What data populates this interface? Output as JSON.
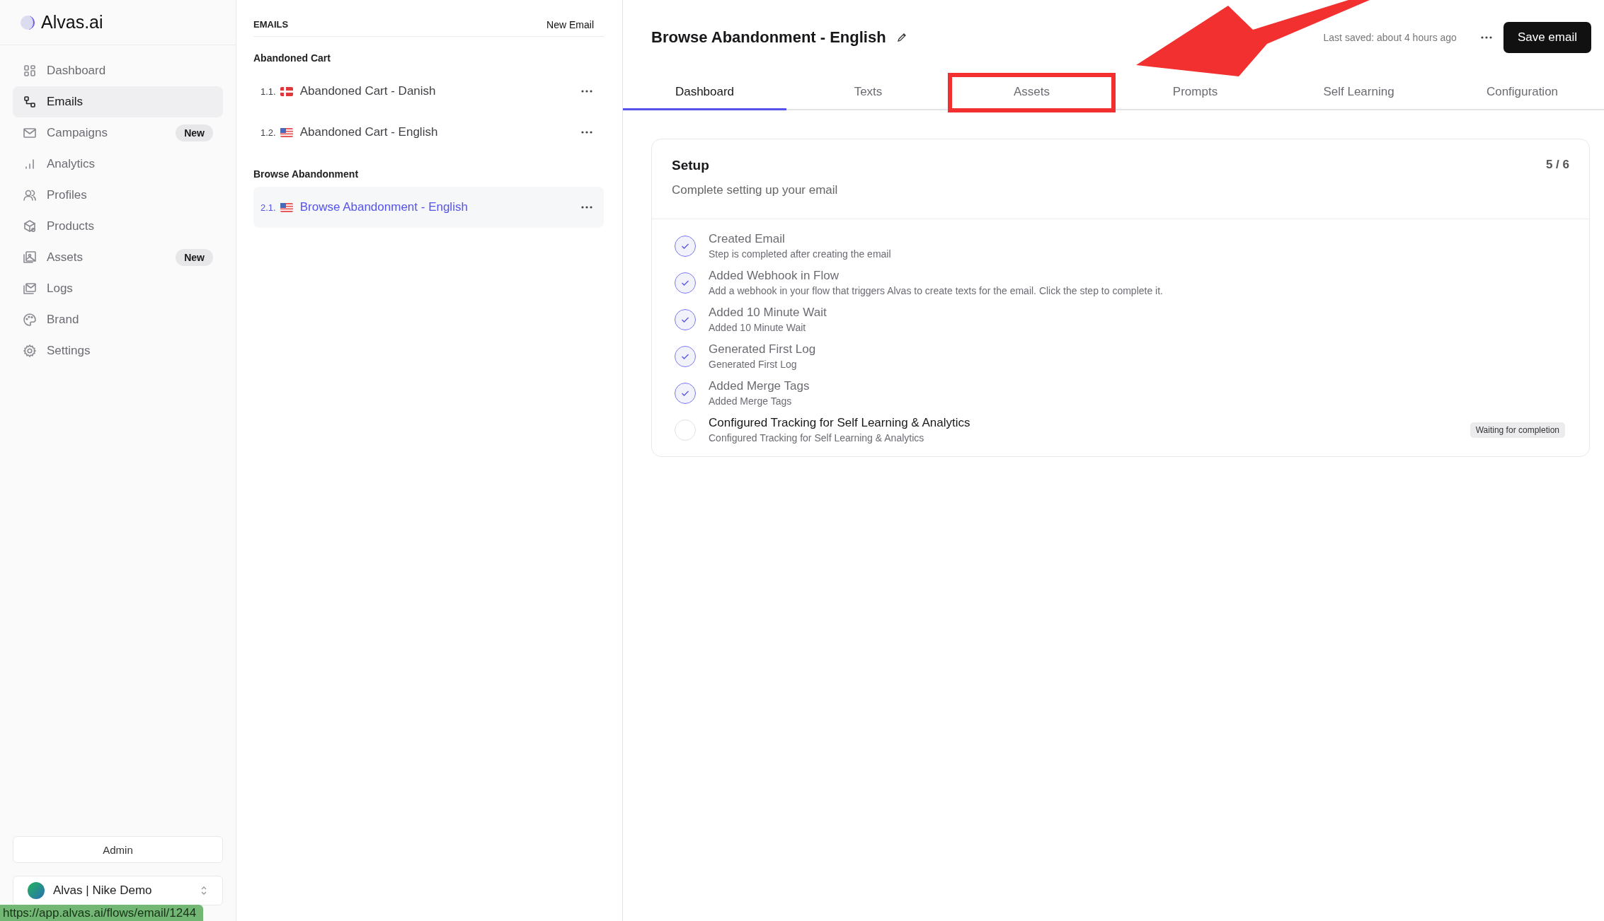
{
  "brand": {
    "name": "Alvas.ai"
  },
  "nav": [
    {
      "label": "Dashboard",
      "selected": false
    },
    {
      "label": "Emails",
      "selected": true
    },
    {
      "label": "Campaigns",
      "selected": false,
      "badge": "New"
    },
    {
      "label": "Analytics",
      "selected": false
    },
    {
      "label": "Profiles",
      "selected": false
    },
    {
      "label": "Products",
      "selected": false
    },
    {
      "label": "Assets",
      "selected": false,
      "badge": "New"
    },
    {
      "label": "Logs",
      "selected": false
    },
    {
      "label": "Brand",
      "selected": false
    },
    {
      "label": "Settings",
      "selected": false
    }
  ],
  "admin_button": "Admin",
  "workspace": {
    "name": "Alvas | Nike Demo"
  },
  "status_url": "https://app.alvas.ai/flows/email/1244",
  "email_list": {
    "heading": "EMAILS",
    "new_button": "New Email",
    "groups": [
      {
        "name": "Abandoned Cart",
        "items": [
          {
            "number": "1.1.",
            "title": "Abandoned Cart - Danish",
            "selected": false
          },
          {
            "number": "1.2.",
            "title": "Abandoned Cart - English",
            "selected": false
          }
        ]
      },
      {
        "name": "Browse Abandonment",
        "items": [
          {
            "number": "2.1.",
            "title": "Browse Abandonment - English",
            "selected": true
          }
        ]
      }
    ]
  },
  "editor": {
    "title": "Browse Abandonment - English",
    "last_saved": "Last saved: about 4 hours ago",
    "save_button": "Save email",
    "tabs": [
      {
        "label": "Dashboard",
        "selected": true,
        "highlighted": false
      },
      {
        "label": "Texts",
        "selected": false,
        "highlighted": false
      },
      {
        "label": "Assets",
        "selected": false,
        "highlighted": true
      },
      {
        "label": "Prompts",
        "selected": false,
        "highlighted": false
      },
      {
        "label": "Self Learning",
        "selected": false,
        "highlighted": false
      },
      {
        "label": "Configuration",
        "selected": false,
        "highlighted": false
      }
    ],
    "setup": {
      "title": "Setup",
      "subtitle": "Complete setting up your email",
      "progress": "5 / 6",
      "steps": [
        {
          "title": "Created Email",
          "description": "Step is completed after creating the email",
          "done": true
        },
        {
          "title": "Added Webhook in Flow",
          "description": "Add a webhook in your flow that triggers Alvas to create texts for the email. Click the step to complete it.",
          "done": true
        },
        {
          "title": "Added 10 Minute Wait",
          "description": "Added 10 Minute Wait",
          "done": true
        },
        {
          "title": "Generated First Log",
          "description": "Generated First Log",
          "done": true
        },
        {
          "title": "Added Merge Tags",
          "description": "Added Merge Tags",
          "done": true
        },
        {
          "title": "Configured Tracking for Self Learning & Analytics",
          "description": "Configured Tracking for Self Learning & Analytics",
          "done": false,
          "badge": "Waiting for completion"
        }
      ]
    }
  }
}
